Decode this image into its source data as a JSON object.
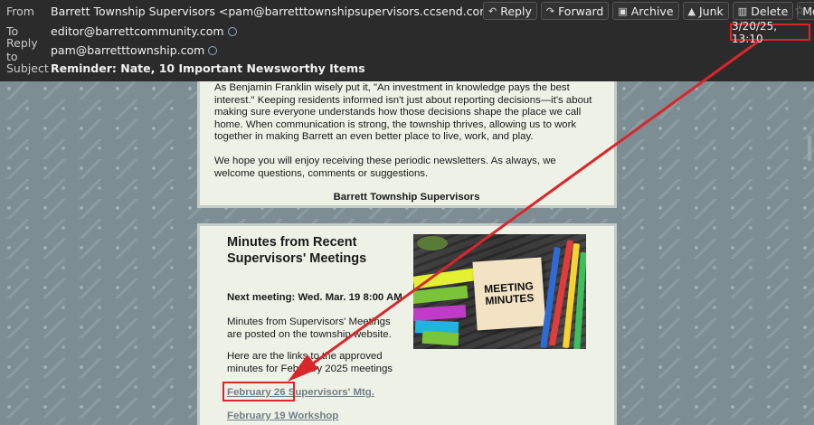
{
  "header": {
    "from_label": "From",
    "from_value": "Barrett Township Supervisors <pam@barretttownshipsupervisors.ccsend.com>",
    "to_label": "To",
    "to_value": "editor@barrettcommunity.com",
    "replyto_label": "Reply to",
    "replyto_value": "pam@barretttownship.com",
    "subject_label": "Subject",
    "subject_value": "Reminder: Nate, 10 Important Newsworthy Items",
    "date": "3/20/25, 13:10"
  },
  "toolbar": {
    "reply": "Reply",
    "forward": "Forward",
    "archive": "Archive",
    "junk": "Junk",
    "delete": "Delete",
    "more": "More"
  },
  "card1": {
    "p1": "As Benjamin Franklin wisely put it, \"An investment in knowledge pays the best interest.\" Keeping residents informed isn't just about reporting decisions—it's about making sure everyone understands how those decisions shape the place we call home. When communication is strong, the township thrives, allowing us to work together in making Barrett an even better place to live, work, and play.",
    "p2": "We hope you will enjoy receiving these periodic newsletters. As always, we welcome questions, comments or suggestions.",
    "signature": "Barrett Township Supervisors"
  },
  "card2": {
    "title": "Minutes from Recent Supervisors' Meetings",
    "next_meeting": "Next meeting: Wed. Mar. 19 8:00 AM",
    "p1": "Minutes from Supervisors' Meetings are posted on the township website.",
    "p2": "Here are the links to the approved minutes for February 2025 meetings",
    "link1": "February 26 Supervisors' Mtg.",
    "link2": "February 19 Workshop",
    "image_text": "MEETING MINUTES"
  },
  "colors": {
    "annotation_red": "#d9262b",
    "link": "#6f8087",
    "header_bg": "#2b2b2b",
    "card_bg": "#eef1e6"
  },
  "icons": [
    "reply-icon",
    "forward-icon",
    "archive-icon",
    "junk-icon",
    "delete-icon",
    "chevron-down-icon",
    "star-icon",
    "verified-icon"
  ]
}
